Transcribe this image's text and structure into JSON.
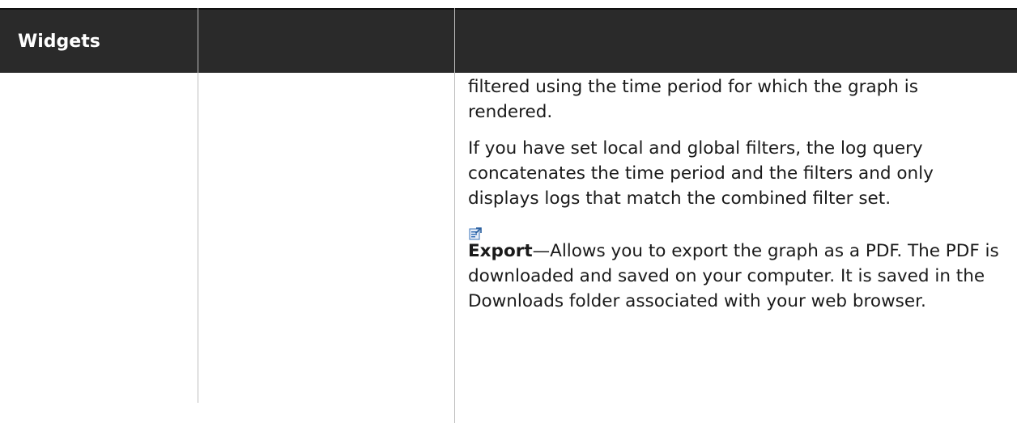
{
  "table": {
    "header": "Widgets",
    "paragraphs": {
      "p1": "filtered using the time period for which the graph is rendered.",
      "p2": "If you have set local and global filters, the log query concatenates the time period and the filters and only displays logs that match the combined filter set.",
      "export_term": "Export",
      "export_desc": "—Allows you to export the graph as a PDF. The PDF is downloaded and saved on your computer. It is saved in the Downloads folder associated with your web browser."
    },
    "icon": "export-icon"
  },
  "colors": {
    "header_bg": "#2a2a2a",
    "header_text": "#ffffff",
    "body_text": "#1a1a1a",
    "divider": "#bdbdbd",
    "icon_blue": "#3a73b8"
  }
}
